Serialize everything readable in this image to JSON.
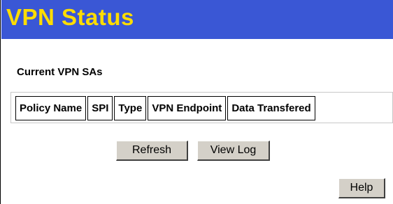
{
  "page": {
    "title": "VPN Status"
  },
  "section": {
    "heading": "Current VPN SAs"
  },
  "table": {
    "columns": [
      "Policy Name",
      "SPI",
      "Type",
      "VPN Endpoint",
      "Data Transfered"
    ],
    "rows": []
  },
  "buttons": {
    "refresh": "Refresh",
    "view_log": "View Log",
    "help": "Help"
  },
  "colors": {
    "title_bar": "#3a57d5",
    "title_text": "#ffdd00",
    "button_face": "#d4d0c8"
  }
}
